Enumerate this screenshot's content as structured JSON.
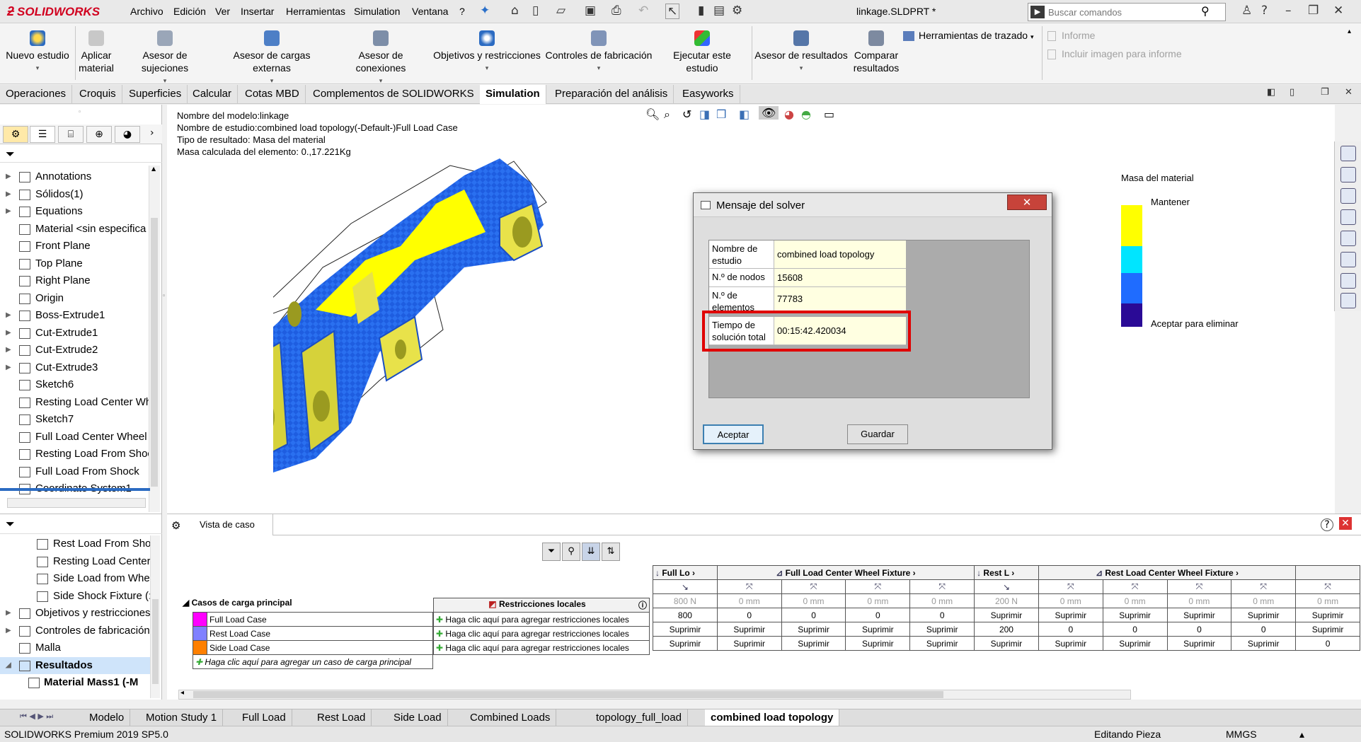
{
  "app": {
    "logo": "SOLIDWORKS",
    "doc_title": "linkage.SLDPRT *",
    "search_placeholder": "Buscar comandos"
  },
  "menu": [
    "Archivo",
    "Edición",
    "Ver",
    "Insertar",
    "Herramientas",
    "Simulation",
    "Ventana",
    "?"
  ],
  "ribbon": {
    "nuevo_estudio": "Nuevo estudio",
    "aplicar_material": "Aplicar material",
    "asesor_sujeciones": "Asesor de sujeciones",
    "asesor_cargas": "Asesor de cargas externas",
    "asesor_conexiones": "Asesor de conexiones",
    "objetivos": "Objetivos y restricciones",
    "controles": "Controles de fabricación",
    "ejecutar": "Ejecutar este estudio",
    "asesor_resultados": "Asesor de resultados",
    "comparar": "Comparar resultados",
    "herramientas_trazado": "Herramientas de trazado",
    "informe": "Informe",
    "incluir_imagen": "Incluir imagen para informe"
  },
  "cm_tabs": [
    "Operaciones",
    "Croquis",
    "Superficies",
    "Calcular",
    "Cotas MBD",
    "Complementos de SOLIDWORKS",
    "Simulation",
    "Preparación del análisis",
    "Easyworks"
  ],
  "cm_active_tab": "Simulation",
  "tree": [
    "Annotations",
    "Sólidos(1)",
    "Equations",
    "Material <sin especifica",
    "Front Plane",
    "Top Plane",
    "Right Plane",
    "Origin",
    "Boss-Extrude1",
    "Cut-Extrude1",
    "Cut-Extrude2",
    "Cut-Extrude3",
    "Sketch6",
    "Resting Load Center Wh",
    "Sketch7",
    "Full Load Center Wheel",
    "Resting Load From Shoc",
    "Full Load From Shock",
    "Coordinate System1"
  ],
  "study_tree": [
    "Rest Load From Shoc",
    "Resting Load Center Wh",
    "Side Load from Whe",
    "Side Shock Fixture (:(",
    "Objetivos y restricciones",
    "Controles de fabricación",
    "Malla",
    "Resultados",
    "Material Mass1 (-M"
  ],
  "viewport": {
    "model_name": "Nombre del modelo:linkage",
    "study_name": "Nombre de estudio:combined load topology(-Default-)Full Load Case",
    "result_type": "Tipo de resultado: Masa del material",
    "mass": "Masa calculada del elemento:  0.,17.221Kg"
  },
  "legend": {
    "title": "Masa del material",
    "keep": "Mantener",
    "remove": "Aceptar para eliminar",
    "colors": [
      "#ffff00",
      "#00e5ff",
      "#1f6cff",
      "#2a0a96"
    ]
  },
  "dialog": {
    "title": "Mensaje del solver",
    "rows": [
      {
        "k": "Nombre de estudio",
        "v": "combined load topology"
      },
      {
        "k": "N.º de nodos",
        "v": "15608"
      },
      {
        "k": "N.º de elementos",
        "v": "77783"
      },
      {
        "k": "Tiempo de solución total",
        "v": "00:15:42.420034"
      }
    ],
    "accept": "Aceptar",
    "save": "Guardar",
    "close": "✕"
  },
  "case_view": {
    "tab": "Vista de caso",
    "main_cases_title": "Casos de carga principal",
    "local_restr_title": "Restricciones locales",
    "add_local": "Haga clic aquí para agregar restricciones locales",
    "add_case": "Haga clic aquí para agregar un caso de carga principal",
    "cases": [
      {
        "name": "Full Load Case",
        "color": "#ff00ff"
      },
      {
        "name": "Rest Load Case",
        "color": "#8080ff"
      },
      {
        "name": "Side Load Case",
        "color": "#ff8000"
      }
    ],
    "group_headers": [
      "Full Lo",
      "Full Load Center Wheel Fixture",
      "Rest L",
      "Rest Load Center Wheel Fixture"
    ],
    "units": [
      "800 N",
      "0 mm",
      "0 mm",
      "0 mm",
      "0 mm",
      "200 N",
      "0 mm",
      "0 mm",
      "0 mm",
      "0 mm",
      "0 mm"
    ],
    "values": [
      [
        "800",
        "0",
        "0",
        "0",
        "0",
        "Suprimir",
        "Suprimir",
        "Suprimir",
        "Suprimir",
        "Suprimir",
        "Suprimir"
      ],
      [
        "Suprimir",
        "Suprimir",
        "Suprimir",
        "Suprimir",
        "Suprimir",
        "200",
        "0",
        "0",
        "0",
        "0",
        "Suprimir"
      ],
      [
        "Suprimir",
        "Suprimir",
        "Suprimir",
        "Suprimir",
        "Suprimir",
        "Suprimir",
        "Suprimir",
        "Suprimir",
        "Suprimir",
        "Suprimir",
        "0"
      ]
    ]
  },
  "sheet_tabs": [
    "Modelo",
    "Motion Study 1",
    "Full Load",
    "Rest Load",
    "Side Load",
    "Combined Loads",
    "topology_full_load",
    "combined load topology"
  ],
  "sheet_active": "combined load topology",
  "status": {
    "product": "SOLIDWORKS Premium 2019 SP5.0",
    "mode": "Editando Pieza",
    "units": "MMGS"
  }
}
